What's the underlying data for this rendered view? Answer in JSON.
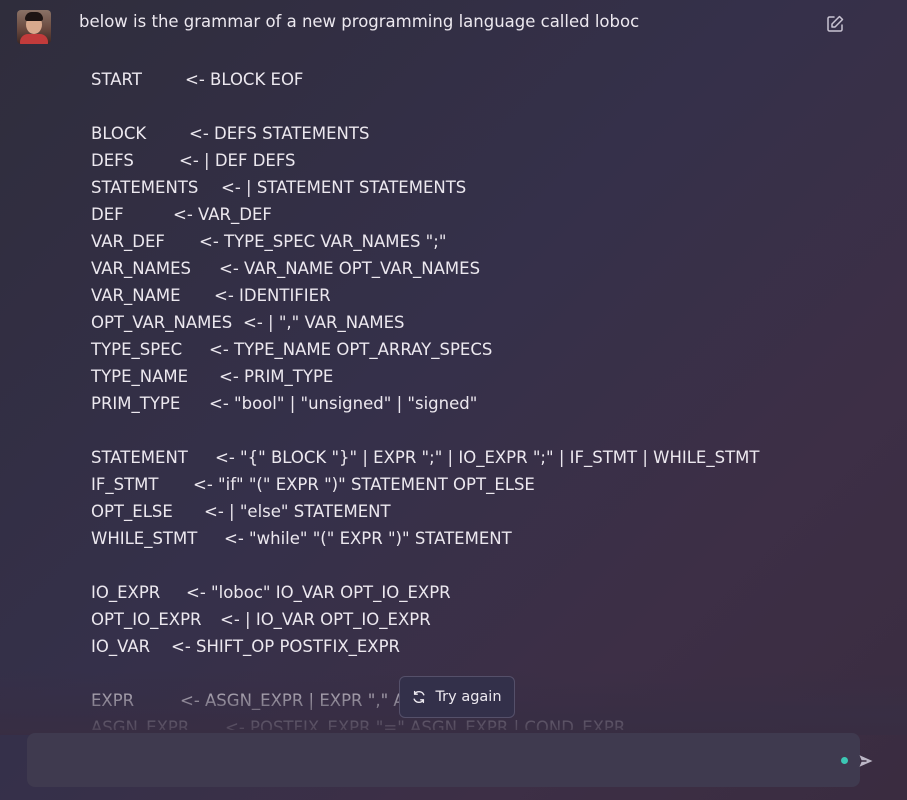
{
  "message": {
    "prompt_line": "below is the grammar of a new programming language called loboc",
    "grammar_sections": [
      [
        {
          "lhs": "START",
          "rhs": "<- BLOCK EOF"
        }
      ],
      [
        {
          "lhs": "BLOCK",
          "rhs": "<- DEFS STATEMENTS"
        },
        {
          "lhs": "DEFS",
          "rhs": "<- | DEF DEFS"
        },
        {
          "lhs": "STATEMENTS",
          "rhs": "<- | STATEMENT STATEMENTS"
        },
        {
          "lhs": "DEF",
          "rhs": "<- VAR_DEF"
        },
        {
          "lhs": "VAR_DEF",
          "rhs": "<- TYPE_SPEC VAR_NAMES \";\""
        },
        {
          "lhs": "VAR_NAMES",
          "rhs": "<- VAR_NAME OPT_VAR_NAMES"
        },
        {
          "lhs": "VAR_NAME",
          "rhs": "<- IDENTIFIER"
        },
        {
          "lhs": "OPT_VAR_NAMES",
          "rhs": "<- | \",\" VAR_NAMES"
        },
        {
          "lhs": "TYPE_SPEC",
          "rhs": "<- TYPE_NAME OPT_ARRAY_SPECS"
        },
        {
          "lhs": "TYPE_NAME",
          "rhs": "<- PRIM_TYPE"
        },
        {
          "lhs": "PRIM_TYPE",
          "rhs": "<- \"bool\" | \"unsigned\" | \"signed\""
        }
      ],
      [
        {
          "lhs": "STATEMENT",
          "rhs": "<- \"{\" BLOCK \"}\" | EXPR \";\" | IO_EXPR \";\" | IF_STMT | WHILE_STMT"
        },
        {
          "lhs": "IF_STMT",
          "rhs": "<- \"if\" \"(\" EXPR \")\" STATEMENT OPT_ELSE"
        },
        {
          "lhs": "OPT_ELSE",
          "rhs": "<- | \"else\" STATEMENT"
        },
        {
          "lhs": "WHILE_STMT",
          "rhs": "<- \"while\" \"(\" EXPR \")\" STATEMENT"
        }
      ],
      [
        {
          "lhs": "IO_EXPR",
          "rhs": "<- \"loboc\" IO_VAR OPT_IO_EXPR"
        },
        {
          "lhs": "OPT_IO_EXPR",
          "rhs": "<- | IO_VAR OPT_IO_EXPR"
        },
        {
          "lhs": "IO_VAR",
          "rhs": "<- SHIFT_OP POSTFIX_EXPR"
        }
      ],
      [
        {
          "lhs": "EXPR",
          "rhs": "<- ASGN_EXPR | EXPR \",\" ASGN_EXPR"
        },
        {
          "lhs": "ASGN_EXPR",
          "rhs": "<- POSTFIX_EXPR \"=\" ASGN_EXPR | COND_EXPR"
        }
      ]
    ]
  },
  "actions": {
    "edit_icon": "edit-icon",
    "try_again_label": "Try again",
    "try_again_icon": "refresh-icon"
  },
  "composer": {
    "placeholder": "",
    "value": "",
    "send_icon": "send-icon"
  },
  "colors": {
    "background": "#35304a",
    "text": "#ece8ef",
    "accent_dot": "#3cc7b4",
    "composer_bg": "#3f3a4f"
  }
}
